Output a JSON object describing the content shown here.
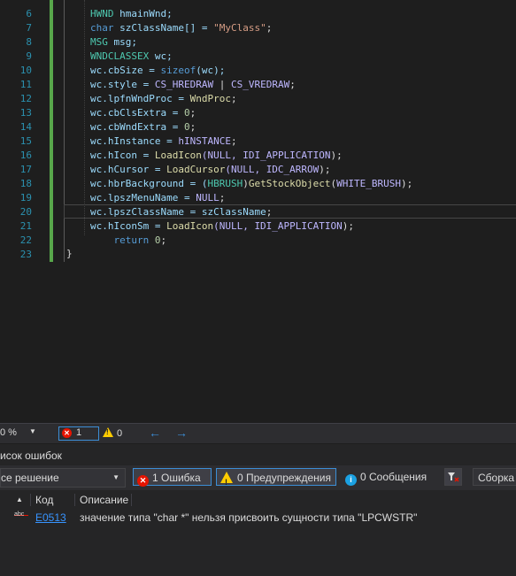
{
  "editor": {
    "lines": [
      {
        "num": "6",
        "tokens": [
          {
            "t": "HWND",
            "c": "t-type"
          },
          {
            "t": " hmainWnd;",
            "c": "t-var"
          }
        ]
      },
      {
        "num": "7",
        "tokens": [
          {
            "t": "char",
            "c": "t-kw"
          },
          {
            "t": " szClassName[] = ",
            "c": "t-var"
          },
          {
            "t": "\"MyClass\"",
            "c": "t-str"
          },
          {
            "t": ";",
            "c": "t-plain"
          }
        ]
      },
      {
        "num": "8",
        "tokens": [
          {
            "t": "MSG",
            "c": "t-type"
          },
          {
            "t": " msg;",
            "c": "t-var"
          }
        ]
      },
      {
        "num": "9",
        "tokens": [
          {
            "t": "WNDCLASSEX",
            "c": "t-type"
          },
          {
            "t": " wc;",
            "c": "t-var"
          }
        ]
      },
      {
        "num": "10",
        "tokens": [
          {
            "t": "wc.cbSize = ",
            "c": "t-var"
          },
          {
            "t": "sizeof",
            "c": "t-kw"
          },
          {
            "t": "(wc);",
            "c": "t-var"
          }
        ]
      },
      {
        "num": "11",
        "tokens": [
          {
            "t": "wc.style = ",
            "c": "t-var"
          },
          {
            "t": "CS_HREDRAW",
            "c": "t-mac"
          },
          {
            "t": " | ",
            "c": "t-plain"
          },
          {
            "t": "CS_VREDRAW",
            "c": "t-mac"
          },
          {
            "t": ";",
            "c": "t-plain"
          }
        ]
      },
      {
        "num": "12",
        "tokens": [
          {
            "t": "wc.lpfnWndProc = ",
            "c": "t-var"
          },
          {
            "t": "WndProc",
            "c": "t-fn"
          },
          {
            "t": ";",
            "c": "t-plain"
          }
        ]
      },
      {
        "num": "13",
        "tokens": [
          {
            "t": "wc.cbClsExtra = ",
            "c": "t-var"
          },
          {
            "t": "0",
            "c": "t-num"
          },
          {
            "t": ";",
            "c": "t-plain"
          }
        ]
      },
      {
        "num": "14",
        "tokens": [
          {
            "t": "wc.cbWndExtra = ",
            "c": "t-var"
          },
          {
            "t": "0",
            "c": "t-num"
          },
          {
            "t": ";",
            "c": "t-plain"
          }
        ]
      },
      {
        "num": "15",
        "tokens": [
          {
            "t": "wc.hInstance = ",
            "c": "t-var"
          },
          {
            "t": "hINSTANCE",
            "c": "t-mac"
          },
          {
            "t": ";",
            "c": "t-plain"
          }
        ]
      },
      {
        "num": "16",
        "tokens": [
          {
            "t": "wc.hIcon = ",
            "c": "t-var"
          },
          {
            "t": "LoadIcon",
            "c": "t-fn"
          },
          {
            "t": "(NULL, ",
            "c": "t-mac"
          },
          {
            "t": "IDI_APPLICATION",
            "c": "t-mac"
          },
          {
            "t": ");",
            "c": "t-plain"
          }
        ]
      },
      {
        "num": "17",
        "tokens": [
          {
            "t": "wc.hCursor = ",
            "c": "t-var"
          },
          {
            "t": "LoadCursor",
            "c": "t-fn"
          },
          {
            "t": "(NULL, ",
            "c": "t-mac"
          },
          {
            "t": "IDC_ARROW",
            "c": "t-mac"
          },
          {
            "t": ");",
            "c": "t-plain"
          }
        ]
      },
      {
        "num": "18",
        "tokens": [
          {
            "t": "wc.hbrBackground = (",
            "c": "t-var"
          },
          {
            "t": "HBRUSH",
            "c": "t-type"
          },
          {
            "t": ")",
            "c": "t-plain"
          },
          {
            "t": "GetStockObject",
            "c": "t-fn"
          },
          {
            "t": "(",
            "c": "t-plain"
          },
          {
            "t": "WHITE_BRUSH",
            "c": "t-mac"
          },
          {
            "t": ");",
            "c": "t-plain"
          }
        ]
      },
      {
        "num": "19",
        "tokens": [
          {
            "t": "wc.lpszMenuName = ",
            "c": "t-var"
          },
          {
            "t": "NULL",
            "c": "t-mac"
          },
          {
            "t": ";",
            "c": "t-plain"
          }
        ]
      },
      {
        "num": "20",
        "tokens": [
          {
            "t": "wc.lpszClassName = ",
            "c": "t-var"
          },
          {
            "t": "szClassName",
            "c": "t-var"
          },
          {
            "t": ";",
            "c": "t-plain"
          }
        ]
      },
      {
        "num": "21",
        "tokens": [
          {
            "t": "wc.hIconSm = ",
            "c": "t-var"
          },
          {
            "t": "LoadIcon",
            "c": "t-fn"
          },
          {
            "t": "(NULL, ",
            "c": "t-mac"
          },
          {
            "t": "IDI_APPLICATION",
            "c": "t-mac"
          },
          {
            "t": ");",
            "c": "t-plain"
          }
        ]
      },
      {
        "num": "22",
        "tokens": [
          {
            "t": "    return ",
            "c": "t-kw"
          },
          {
            "t": "0",
            "c": "t-num"
          },
          {
            "t": ";",
            "c": "t-plain"
          }
        ]
      },
      {
        "num": "23",
        "tokens": []
      }
    ],
    "closing_brace": "}"
  },
  "statusbar": {
    "zoom": "0 %",
    "error_count": "1",
    "warning_count": "0",
    "back_arrow": "←",
    "forward_arrow": "→"
  },
  "errors_panel": {
    "title": "исок ошибок",
    "scope": "се решение",
    "errors_button": "1 Ошибка",
    "warnings_button": "0 Предупреждения",
    "messages_button": "0 Сообщения",
    "build_selector": "Сборка",
    "columns": {
      "code": "Код",
      "description": "Описание"
    },
    "sort_indicator": "▲",
    "rows": [
      {
        "icon_text": "abc",
        "code": "E0513",
        "description": "значение типа \"char *\" нельзя присвоить сущности типа \"LPCWSTR\""
      }
    ]
  },
  "colors": {
    "error": "#e51400",
    "warning": "#ffcc00",
    "info": "#1ba1e2",
    "accent": "#3c8ed6",
    "change_bar": "#57a64a"
  }
}
